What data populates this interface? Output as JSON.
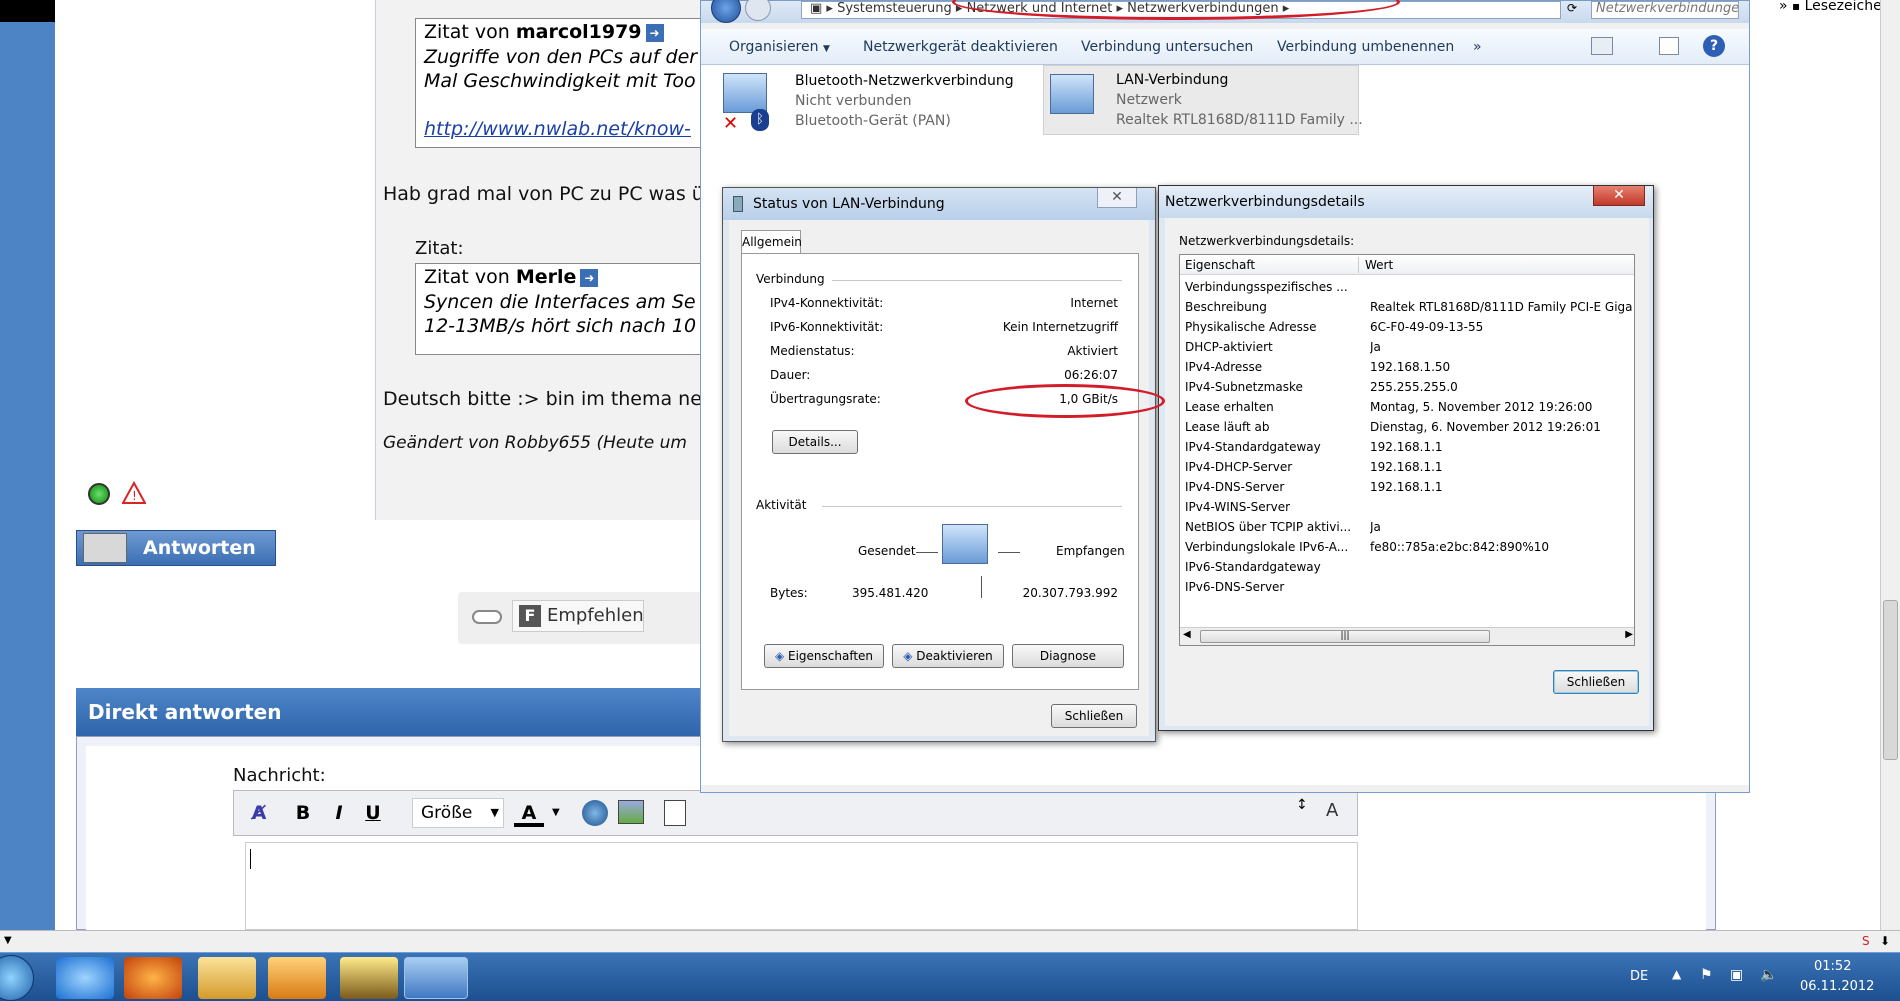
{
  "browser": {
    "bookmarks_label": "Lesezeichen",
    "overflow_chevron": "»"
  },
  "forum": {
    "quote1": {
      "author_prefix": "Zitat von ",
      "author": "marcol1979",
      "lines": [
        "Zugriffe von den PCs auf der",
        "Mal Geschwindigkeit mit Too"
      ],
      "link": "http://www.nwlab.net/know-"
    },
    "reply_text": "Hab grad mal von PC zu PC was ü",
    "zitat_label": "Zitat:",
    "quote2": {
      "author_prefix": "Zitat von ",
      "author": "Merle",
      "lines": [
        "Syncen die Interfaces am Se",
        "12-13MB/s hört sich nach 10"
      ]
    },
    "reply2": "Deutsch bitte :> bin im thema ne",
    "edited": "Geändert von Robby655 (Heute um",
    "antworten": "Antworten",
    "empfehlen": "Empfehlen",
    "direkt_antworten": "Direkt antworten",
    "nachricht": "Nachricht:",
    "toolbar": {
      "bold": "B",
      "italic": "I",
      "underline": "U",
      "size": "Größe",
      "color_a": "A"
    }
  },
  "explorer": {
    "address": {
      "segments": [
        "Systemsteuerung",
        "Netzwerk und Internet",
        "Netzwerkverbindungen"
      ],
      "search_placeholder": "Netzwerkverbindungen durchs..."
    },
    "commands": [
      "Organisieren",
      "Netzwerkgerät deaktivieren",
      "Verbindung untersuchen",
      "Verbindung umbenennen",
      "»"
    ],
    "connections": [
      {
        "name": "Bluetooth-Netzwerkverbindung",
        "status": "Nicht verbunden",
        "device": "Bluetooth-Gerät (PAN)"
      },
      {
        "name": "LAN-Verbindung",
        "status": "Netzwerk",
        "device": "Realtek RTL8168D/8111D Family ..."
      }
    ]
  },
  "status_dialog": {
    "title": "Status von LAN-Verbindung",
    "tab": "Allgemein",
    "section_connection": "Verbindung",
    "rows": [
      {
        "label": "IPv4-Konnektivität:",
        "value": "Internet"
      },
      {
        "label": "IPv6-Konnektivität:",
        "value": "Kein Internetzugriff"
      },
      {
        "label": "Medienstatus:",
        "value": "Aktiviert"
      },
      {
        "label": "Dauer:",
        "value": "06:26:07"
      },
      {
        "label": "Übertragungsrate:",
        "value": "1,0 GBit/s"
      }
    ],
    "details_btn": "Details...",
    "section_activity": "Aktivität",
    "sent_label": "Gesendet",
    "received_label": "Empfangen",
    "bytes_label": "Bytes:",
    "bytes_sent": "395.481.420",
    "bytes_received": "20.307.793.992",
    "btn_properties": "Eigenschaften",
    "btn_disable": "Deaktivieren",
    "btn_diagnose": "Diagnose",
    "btn_close": "Schließen"
  },
  "details_dialog": {
    "title": "Netzwerkverbindungsdetails",
    "caption": "Netzwerkverbindungsdetails:",
    "col_property": "Eigenschaft",
    "col_value": "Wert",
    "rows": [
      {
        "p": "Verbindungsspezifisches ...",
        "v": ""
      },
      {
        "p": "Beschreibung",
        "v": "Realtek RTL8168D/8111D Family PCI-E Giga"
      },
      {
        "p": "Physikalische Adresse",
        "v": "6C-F0-49-09-13-55"
      },
      {
        "p": "DHCP-aktiviert",
        "v": "Ja"
      },
      {
        "p": "IPv4-Adresse",
        "v": "192.168.1.50"
      },
      {
        "p": "IPv4-Subnetzmaske",
        "v": "255.255.255.0"
      },
      {
        "p": "Lease erhalten",
        "v": "Montag, 5. November 2012 19:26:00"
      },
      {
        "p": "Lease läuft ab",
        "v": "Dienstag, 6. November 2012 19:26:01"
      },
      {
        "p": "IPv4-Standardgateway",
        "v": "192.168.1.1"
      },
      {
        "p": "IPv4-DHCP-Server",
        "v": "192.168.1.1"
      },
      {
        "p": "IPv4-DNS-Server",
        "v": "192.168.1.1"
      },
      {
        "p": "IPv4-WINS-Server",
        "v": ""
      },
      {
        "p": "NetBIOS über TCPIP aktivi...",
        "v": "Ja"
      },
      {
        "p": "Verbindungslokale IPv6-A...",
        "v": "fe80::785a:e2bc:842:890%10"
      },
      {
        "p": "IPv6-Standardgateway",
        "v": ""
      },
      {
        "p": "IPv6-DNS-Server",
        "v": ""
      }
    ],
    "btn_close": "Schließen"
  },
  "taskbar": {
    "lang": "DE",
    "time": "01:52",
    "date": "06.11.2012"
  },
  "colors": {
    "annotation": "#d21c2a",
    "accent": "#2e64ab"
  }
}
